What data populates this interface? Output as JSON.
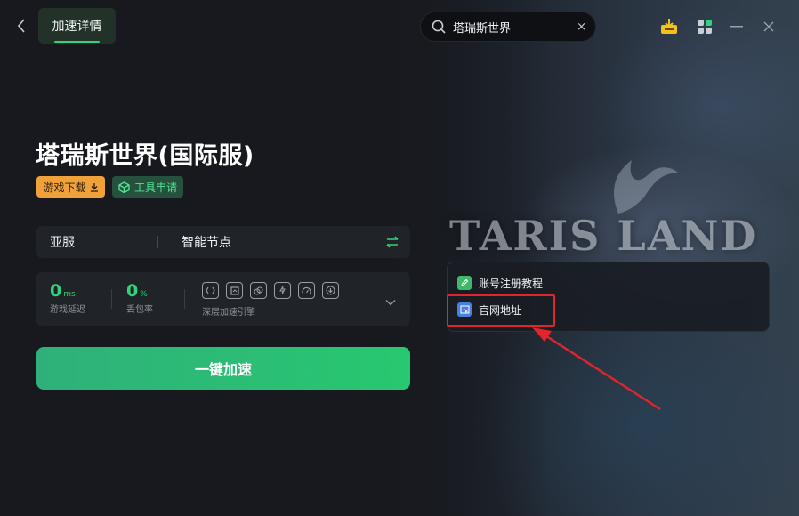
{
  "header": {
    "title_tab": "加速详情",
    "search_value": "塔瑞斯世界",
    "clear_icon": "×"
  },
  "game": {
    "title": "塔瑞斯世界(国际服)",
    "download_label": "游戏下载",
    "tool_label": "工具申请"
  },
  "route": {
    "region": "亚服",
    "node": "智能节点"
  },
  "stats": {
    "latency_value": "0",
    "latency_unit": "ms",
    "latency_label": "游戏延迟",
    "loss_value": "0",
    "loss_unit": "%",
    "loss_label": "丢包率",
    "engine_label": "深层加速引擎"
  },
  "accelerate_label": "一键加速",
  "popup": {
    "items": [
      {
        "label": "账号注册教程"
      },
      {
        "label": "官网地址"
      }
    ]
  },
  "art_text": "TARIS LAND",
  "colors": {
    "accent": "#2fd47c",
    "download_bg": "#f0a13a",
    "highlight": "#e0262a"
  }
}
